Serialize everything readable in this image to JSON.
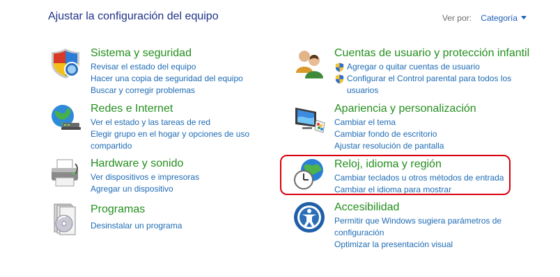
{
  "header": {
    "title": "Ajustar la configuración del equipo",
    "view_by_label": "Ver por:",
    "view_by_value": "Categoría"
  },
  "categories": [
    {
      "title": "Sistema y seguridad",
      "icon": "security-shield-icon",
      "links": [
        "Revisar el estado del equipo",
        "Hacer una copia de seguridad del equipo",
        "Buscar y corregir problemas"
      ]
    },
    {
      "title": "Redes e Internet",
      "icon": "network-globe-icon",
      "links": [
        "Ver el estado y las tareas de red",
        "Elegir grupo en el hogar y opciones de uso compartido"
      ]
    },
    {
      "title": "Hardware y sonido",
      "icon": "printer-icon",
      "links": [
        "Ver dispositivos e impresoras",
        "Agregar un dispositivo"
      ]
    },
    {
      "title": "Programas",
      "icon": "programs-disc-icon",
      "links": [
        "Desinstalar un programa"
      ]
    },
    {
      "title": "Cuentas de usuario y protección infantil",
      "icon": "users-icon",
      "links": [
        "Agregar o quitar cuentas de usuario",
        "Configurar el Control parental para todos los usuarios"
      ]
    },
    {
      "title": "Apariencia y personalización",
      "icon": "monitor-palette-icon",
      "links": [
        "Cambiar el tema",
        "Cambiar fondo de escritorio",
        "Ajustar resolución de pantalla"
      ]
    },
    {
      "title": "Reloj, idioma y región",
      "icon": "clock-globe-icon",
      "links": [
        "Cambiar teclados u otros métodos de entrada",
        "Cambiar el idioma para mostrar"
      ]
    },
    {
      "title": "Accesibilidad",
      "icon": "accessibility-icon",
      "links": [
        "Permitir que Windows sugiera parámetros de configuración",
        "Optimizar la presentación visual"
      ]
    }
  ]
}
